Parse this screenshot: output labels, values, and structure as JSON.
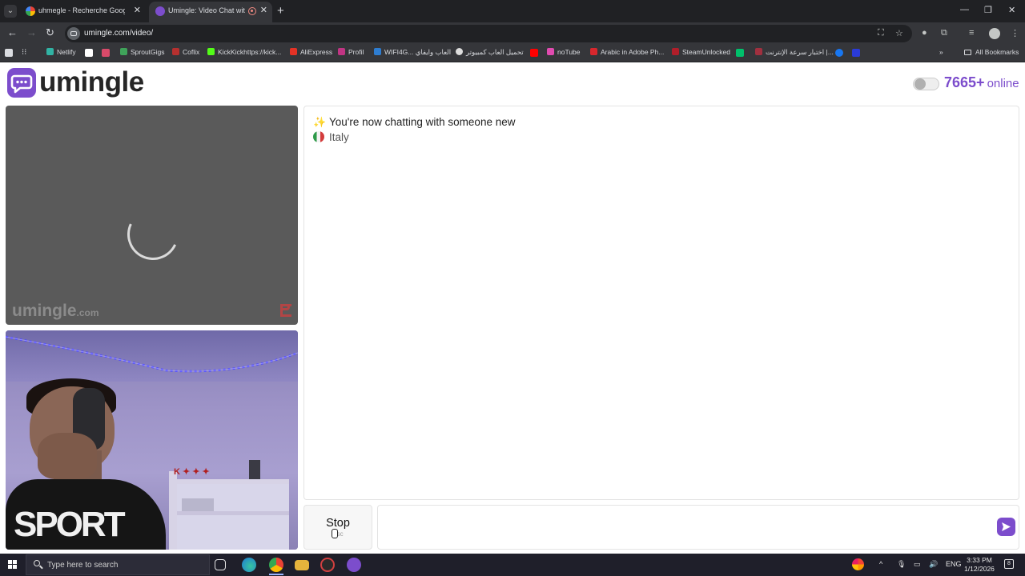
{
  "browser": {
    "tabs": [
      {
        "title": "uhmegle - Recherche Google",
        "active": false
      },
      {
        "title": "Umingle: Video Chat with St",
        "active": true
      }
    ],
    "url": "umingle.com/video/",
    "bookmarks": [
      {
        "label": "Netlify",
        "color": "#31b3a4"
      },
      {
        "label": "",
        "color": "#ffffff"
      },
      {
        "label": "",
        "color": "#d84a6a"
      },
      {
        "label": "SproutGigs",
        "color": "#3fa35a"
      },
      {
        "label": "Coflix",
        "color": "#b5302f"
      },
      {
        "label": "KickKickhttps://kick...",
        "color": "#53fc18"
      },
      {
        "label": "AliExpress",
        "color": "#e43225"
      },
      {
        "label": "Profil",
        "color": "#c13584"
      },
      {
        "label": "WIFI4G... العاب وايفاي",
        "color": "#2e7dd1"
      },
      {
        "label": "تحميل العاب كمبيوتر",
        "color": "#dddddd"
      },
      {
        "label": "",
        "color": "#ff0000"
      },
      {
        "label": "noTube",
        "color": "#e04bb0"
      },
      {
        "label": "Arabic in Adobe Ph...",
        "color": "#d8272d"
      },
      {
        "label": "SteamUnlocked",
        "color": "#b01e2a"
      },
      {
        "label": "",
        "color": "#00c06b"
      },
      {
        "label": "اختبار سرعة الإنترنت |...",
        "color": "#a0303f"
      },
      {
        "label": "",
        "color": "#1877f2"
      },
      {
        "label": "",
        "color": "#2a3bd8"
      }
    ],
    "all_bookmarks": "All Bookmarks"
  },
  "site": {
    "logo": "umingle",
    "brand_color": "#7c4dcc",
    "online_count": "7665+",
    "online_label": "online"
  },
  "video": {
    "watermark": "umingle",
    "watermark_domain": ".com",
    "overlay_lettering": "SPORT"
  },
  "chat": {
    "system_message": "You're now chatting with someone new",
    "country": "Italy",
    "stop_label": "Stop",
    "stop_hint": "Esc",
    "input_placeholder": ""
  },
  "taskbar": {
    "search_placeholder": "Type here to search",
    "language": "ENG",
    "time": "3:33 PM",
    "date": "1/12/2026",
    "notifications": "8"
  }
}
